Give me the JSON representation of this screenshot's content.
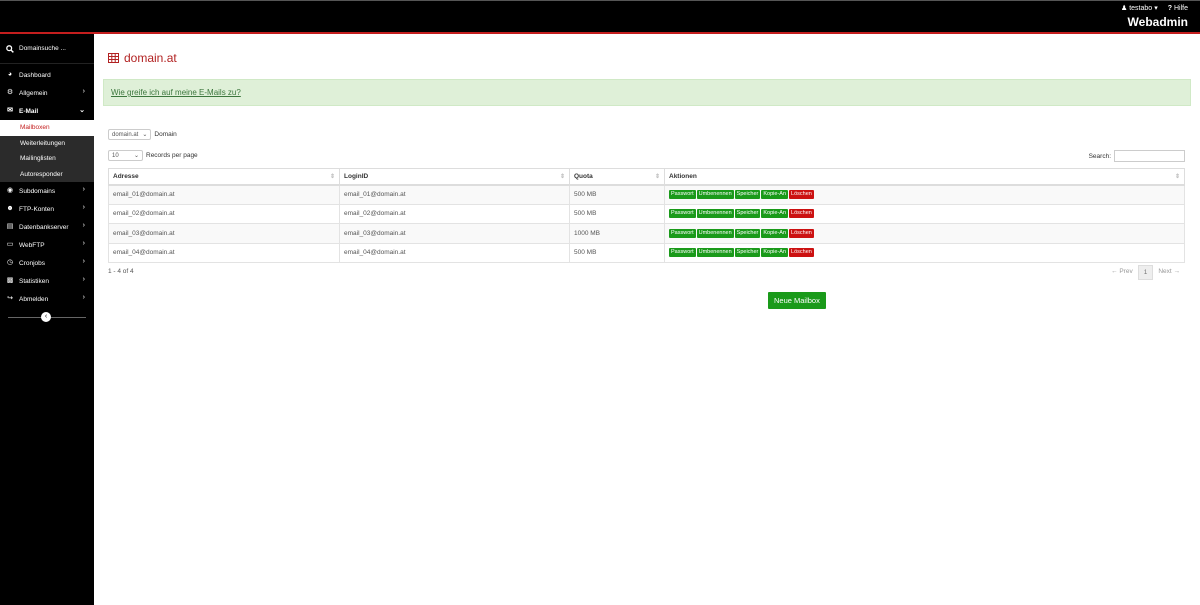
{
  "header": {
    "user": "testabo",
    "help": "Hilfe",
    "brand": "Webadmin"
  },
  "sidebar": {
    "search_placeholder": "Domainsuche ...",
    "items": [
      {
        "label": "Dashboard",
        "icon": "dashboard-icon"
      },
      {
        "label": "Allgemein",
        "icon": "gear-icon"
      },
      {
        "label": "E-Mail",
        "icon": "envelope-icon"
      },
      {
        "label": "Subdomains",
        "icon": "globe-icon"
      },
      {
        "label": "FTP-Konten",
        "icon": "users-icon"
      },
      {
        "label": "Datenbankserver",
        "icon": "server-icon"
      },
      {
        "label": "WebFTP",
        "icon": "folder-icon"
      },
      {
        "label": "Cronjobs",
        "icon": "clock-icon"
      },
      {
        "label": "Statistiken",
        "icon": "bar-chart-icon"
      },
      {
        "label": "Abmelden",
        "icon": "sign-out-icon"
      }
    ],
    "email_subitems": [
      "Mailboxen",
      "Weiterleitungen",
      "Mailinglisten",
      "Autoresponder"
    ]
  },
  "main": {
    "title": "domain.at",
    "help_link": "Wie greife ich auf meine E-Mails zu?",
    "domain_select": "domain.at",
    "domain_label": "Domain",
    "records_select": "10",
    "records_label": "Records per page",
    "search_label": "Search:",
    "columns": [
      "Adresse",
      "LoginID",
      "Quota",
      "Aktionen"
    ],
    "rows": [
      {
        "adresse": "email_01@domain.at",
        "login": "email_01@domain.at",
        "quota": "500 MB"
      },
      {
        "adresse": "email_02@domain.at",
        "login": "email_02@domain.at",
        "quota": "500 MB"
      },
      {
        "adresse": "email_03@domain.at",
        "login": "email_03@domain.at",
        "quota": "1000 MB"
      },
      {
        "adresse": "email_04@domain.at",
        "login": "email_04@domain.at",
        "quota": "500 MB"
      }
    ],
    "actions": [
      "Passwort",
      "Umbenennen",
      "Speicher",
      "Kopie-An",
      "Löschen"
    ],
    "info": "1 - 4 of 4",
    "pager": {
      "prev": "← Prev",
      "page": "1",
      "next": "Next →"
    },
    "new_button": "Neue Mailbox"
  }
}
